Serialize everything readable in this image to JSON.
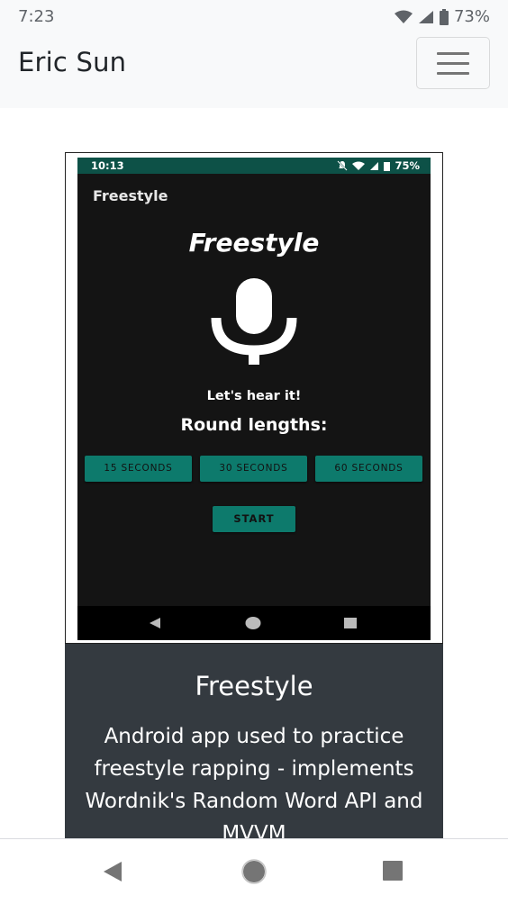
{
  "status_bar": {
    "time": "7:23",
    "battery": "73%",
    "icons": [
      "wifi-icon",
      "signal-icon",
      "battery-icon"
    ]
  },
  "navbar": {
    "brand": "Eric Sun",
    "menu_icon": "hamburger-menu-icon"
  },
  "project": {
    "screenshot": {
      "status_time": "10:13",
      "status_battery": "75%",
      "app_bar_title": "Freestyle",
      "heading": "Freestyle",
      "mic_icon": "microphone-icon",
      "subtitle": "Let's hear it!",
      "round_label": "Round lengths:",
      "buttons": [
        "15 SECONDS",
        "30 SECONDS",
        "60 SECONDS"
      ],
      "start_label": "START",
      "accent": "#0d7a6c"
    },
    "title": "Freestyle",
    "description": "Android app used to practice freestyle rapping - implements Wordnik's Random Word API and MVVM"
  },
  "system_nav": [
    "back-icon",
    "home-icon",
    "recents-icon"
  ]
}
